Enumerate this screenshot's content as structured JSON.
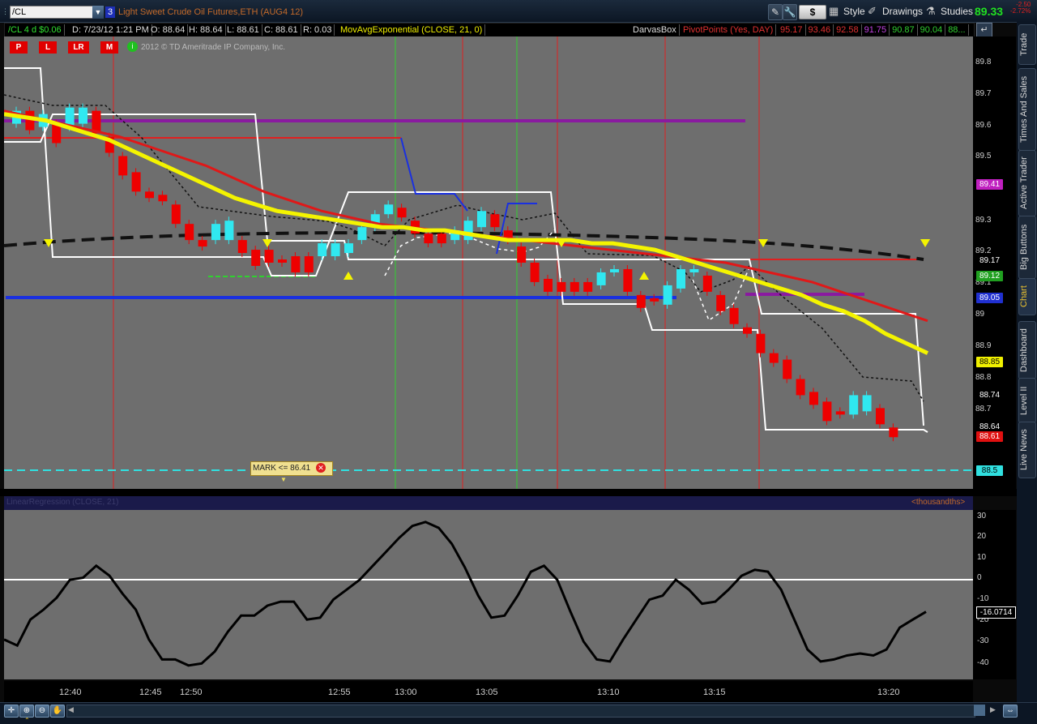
{
  "toolbar": {
    "symbol": "/CL",
    "link_number": "3",
    "instrument_description": "Light Sweet Crude Oil Futures,ETH (AUG4 12)",
    "currency_label": "$",
    "style_label": "Style",
    "drawings_label": "Drawings",
    "studies_label": "Studies",
    "last_price": "89.33",
    "net_change": "-2.50",
    "net_change_pct": "-2.72%"
  },
  "infobar": {
    "chart_label": "/CL 4 d $0.06",
    "date": "D: 7/23/12 1:21 PM",
    "open": "O: 88.64",
    "high": "H: 88.64",
    "low": "L: 88.61",
    "close": "C: 88.61",
    "range": "R: 0.03",
    "study_ema": "MovAvgExponential (CLOSE, 21, 0)",
    "study_darvas": "DarvasBox",
    "study_pivots": "PivotPoints (Yes, DAY)",
    "pivot_values": [
      "95.17",
      "93.46",
      "92.58",
      "91.75",
      "90.87",
      "90.04",
      "88..."
    ],
    "pivot_colors": [
      "#e03030",
      "#e03030",
      "#e03030",
      "#c040e0",
      "#30d030",
      "#30d030",
      "#30d030"
    ]
  },
  "chart_buttons": [
    "P",
    "L",
    "LR",
    "M"
  ],
  "copyright": "2012 © TD Ameritrade IP Company, Inc.",
  "price_axis": {
    "labels": [
      "89.8",
      "89.7",
      "89.6",
      "89.5",
      "89.3",
      "89.2",
      "89.1",
      "89",
      "88.9",
      "88.8",
      "88.7"
    ],
    "badges": [
      {
        "value": "89.41",
        "bg": "#c020c0",
        "fg": "#fff"
      },
      {
        "value": "89.17",
        "bg": "#000",
        "fg": "#fff"
      },
      {
        "value": "89.12",
        "bg": "#20a020",
        "fg": "#fff"
      },
      {
        "value": "89.05",
        "bg": "#2030d0",
        "fg": "#fff"
      },
      {
        "value": "88.85",
        "bg": "#f0f000",
        "fg": "#000"
      },
      {
        "value": "88.74",
        "bg": "#000",
        "fg": "#fff"
      },
      {
        "value": "88.64",
        "bg": "#000",
        "fg": "#fff"
      },
      {
        "value": "88.61",
        "bg": "#e01010",
        "fg": "#fff"
      },
      {
        "value": "88.5",
        "bg": "#30e0e0",
        "fg": "#000"
      }
    ]
  },
  "mark_alert": "MARK <= 86.41",
  "lower_study": {
    "header": "LinearRegression (CLOSE, 21)",
    "units": "<thousandths>",
    "axis_labels": [
      "30",
      "20",
      "10",
      "0",
      "-10",
      "-20",
      "-30",
      "-40"
    ],
    "current_value": "-16.0714"
  },
  "time_axis": [
    "12:40",
    "12:45",
    "12:50",
    "12:55",
    "13:00",
    "13:05",
    "13:10",
    "13:15",
    "13:20"
  ],
  "right_tabs": [
    "Trade",
    "Times And Sales",
    "Active Trader",
    "Big Buttons",
    "Chart",
    "Dashboard",
    "Level II",
    "Live News"
  ],
  "chart_data": {
    "type": "candlestick",
    "ylim": [
      88.45,
      89.85
    ],
    "candles": [
      {
        "o": 89.58,
        "c": 89.62,
        "dir": "up"
      },
      {
        "o": 89.62,
        "c": 89.56,
        "dir": "down"
      },
      {
        "o": 89.57,
        "c": 89.61,
        "dir": "up"
      },
      {
        "o": 89.58,
        "c": 89.52,
        "dir": "down"
      },
      {
        "o": 89.57,
        "c": 89.63,
        "dir": "up"
      },
      {
        "o": 89.58,
        "c": 89.63,
        "dir": "up"
      },
      {
        "o": 89.62,
        "c": 89.55,
        "dir": "down"
      },
      {
        "o": 89.54,
        "c": 89.49,
        "dir": "down"
      },
      {
        "o": 89.48,
        "c": 89.42,
        "dir": "down"
      },
      {
        "o": 89.43,
        "c": 89.37,
        "dir": "down"
      },
      {
        "o": 89.37,
        "c": 89.35,
        "dir": "down"
      },
      {
        "o": 89.36,
        "c": 89.34,
        "dir": "down"
      },
      {
        "o": 89.33,
        "c": 89.27,
        "dir": "down"
      },
      {
        "o": 89.27,
        "c": 89.22,
        "dir": "down"
      },
      {
        "o": 89.22,
        "c": 89.2,
        "dir": "down"
      },
      {
        "o": 89.22,
        "c": 89.27,
        "dir": "up"
      },
      {
        "o": 89.22,
        "c": 89.28,
        "dir": "up"
      },
      {
        "o": 89.22,
        "c": 89.18,
        "dir": "down"
      },
      {
        "o": 89.19,
        "c": 89.14,
        "dir": "down"
      },
      {
        "o": 89.19,
        "c": 89.15,
        "dir": "down"
      },
      {
        "o": 89.16,
        "c": 89.15,
        "dir": "down"
      },
      {
        "o": 89.17,
        "c": 89.12,
        "dir": "down"
      },
      {
        "o": 89.17,
        "c": 89.12,
        "dir": "down"
      },
      {
        "o": 89.17,
        "c": 89.21,
        "dir": "up"
      },
      {
        "o": 89.17,
        "c": 89.21,
        "dir": "up"
      },
      {
        "o": 89.18,
        "c": 89.21,
        "dir": "up"
      },
      {
        "o": 89.22,
        "c": 89.26,
        "dir": "up"
      },
      {
        "o": 89.26,
        "c": 89.3,
        "dir": "up"
      },
      {
        "o": 89.3,
        "c": 89.33,
        "dir": "up"
      },
      {
        "o": 89.32,
        "c": 89.29,
        "dir": "down"
      },
      {
        "o": 89.28,
        "c": 89.24,
        "dir": "down"
      },
      {
        "o": 89.24,
        "c": 89.21,
        "dir": "down"
      },
      {
        "o": 89.24,
        "c": 89.21,
        "dir": "down"
      },
      {
        "o": 89.22,
        "c": 89.25,
        "dir": "up"
      },
      {
        "o": 89.22,
        "c": 89.28,
        "dir": "up"
      },
      {
        "o": 89.26,
        "c": 89.31,
        "dir": "up"
      },
      {
        "o": 89.3,
        "c": 89.26,
        "dir": "down"
      },
      {
        "o": 89.25,
        "c": 89.22,
        "dir": "down"
      },
      {
        "o": 89.2,
        "c": 89.15,
        "dir": "down"
      },
      {
        "o": 89.15,
        "c": 89.09,
        "dir": "down"
      },
      {
        "o": 89.1,
        "c": 89.06,
        "dir": "down"
      },
      {
        "o": 89.09,
        "c": 89.06,
        "dir": "down"
      },
      {
        "o": 89.09,
        "c": 89.06,
        "dir": "down"
      },
      {
        "o": 89.09,
        "c": 89.06,
        "dir": "down"
      },
      {
        "o": 89.08,
        "c": 89.12,
        "dir": "up"
      },
      {
        "o": 89.12,
        "c": 89.13,
        "dir": "up"
      },
      {
        "o": 89.13,
        "c": 89.06,
        "dir": "down"
      },
      {
        "o": 89.05,
        "c": 89.01,
        "dir": "down"
      },
      {
        "o": 89.03,
        "c": 89.04,
        "dir": "down"
      },
      {
        "o": 89.02,
        "c": 89.08,
        "dir": "up"
      },
      {
        "o": 89.07,
        "c": 89.13,
        "dir": "up"
      },
      {
        "o": 89.12,
        "c": 89.13,
        "dir": "up"
      },
      {
        "o": 89.11,
        "c": 89.06,
        "dir": "down"
      },
      {
        "o": 89.05,
        "c": 89.0,
        "dir": "down"
      },
      {
        "o": 89.01,
        "c": 88.96,
        "dir": "down"
      },
      {
        "o": 88.95,
        "c": 88.93,
        "dir": "down"
      },
      {
        "o": 88.93,
        "c": 88.87,
        "dir": "down"
      },
      {
        "o": 88.87,
        "c": 88.84,
        "dir": "down"
      },
      {
        "o": 88.85,
        "c": 88.79,
        "dir": "down"
      },
      {
        "o": 88.79,
        "c": 88.74,
        "dir": "down"
      },
      {
        "o": 88.75,
        "c": 88.71,
        "dir": "down"
      },
      {
        "o": 88.72,
        "c": 88.66,
        "dir": "down"
      },
      {
        "o": 88.69,
        "c": 88.68,
        "dir": "down"
      },
      {
        "o": 88.68,
        "c": 88.74,
        "dir": "up"
      },
      {
        "o": 88.69,
        "c": 88.74,
        "dir": "up"
      },
      {
        "o": 88.7,
        "c": 88.65,
        "dir": "down"
      },
      {
        "o": 88.64,
        "c": 88.61,
        "dir": "down"
      }
    ],
    "ema_fast": [
      89.61,
      89.6,
      89.59,
      89.57,
      89.55,
      89.53,
      89.5,
      89.47,
      89.44,
      89.41,
      89.38,
      89.35,
      89.33,
      89.31,
      89.3,
      89.29,
      89.28,
      89.27,
      89.26,
      89.26,
      89.25,
      89.25,
      89.24,
      89.23,
      89.22,
      89.22,
      89.22,
      89.22,
      89.21,
      89.21,
      89.2,
      89.19,
      89.17,
      89.15,
      89.13,
      89.11,
      89.09,
      89.07,
      89.05,
      89.02,
      89.0,
      88.97,
      88.93,
      88.9,
      88.87
    ],
    "ema_slow": [
      89.62,
      89.6,
      89.58,
      89.56,
      89.54,
      89.51,
      89.48,
      89.45,
      89.41,
      89.37,
      89.34,
      89.31,
      89.29,
      89.27,
      89.26,
      89.25,
      89.24,
      89.23,
      89.22,
      89.21,
      89.2,
      89.19,
      89.18,
      89.17,
      89.16,
      89.15,
      89.13,
      89.11,
      89.09,
      89.06,
      89.03,
      89.0,
      88.97
    ],
    "oscillator": [
      -30,
      -33,
      -20,
      -15,
      -9,
      0,
      1,
      7,
      2,
      -7,
      -15,
      -30,
      -40,
      -40,
      -43,
      -42,
      -36,
      -26,
      -18,
      -18,
      -13,
      -11,
      -11,
      -20,
      -19,
      -10,
      -5,
      0,
      7,
      14,
      21,
      27,
      29,
      26,
      18,
      6,
      -8,
      -19,
      -18,
      -8,
      4,
      7,
      0,
      -16,
      -31,
      -40,
      -41,
      -30,
      -20,
      -10,
      -8,
      0,
      -5,
      -12,
      -11,
      -5,
      2,
      5,
      4,
      -5,
      -20,
      -35,
      -41,
      -40,
      -38,
      -37,
      -38,
      -35,
      -24,
      -20,
      -16.07
    ]
  }
}
